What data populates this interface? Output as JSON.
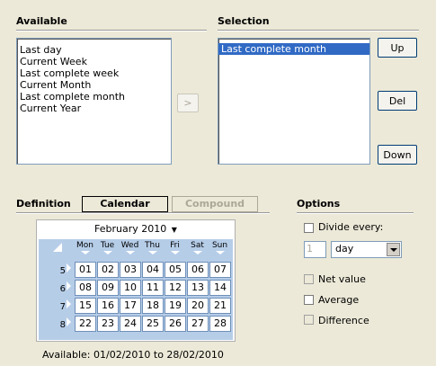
{
  "available": {
    "title": "Available",
    "items": [
      "Last day",
      "Current Week",
      "Last complete week",
      "Current Month",
      "Last complete month",
      "Current Year"
    ]
  },
  "move_button": {
    "label": ">"
  },
  "selection": {
    "title": "Selection",
    "items": [
      "Last complete month"
    ],
    "selected_index": 0
  },
  "side_buttons": {
    "up": "Up",
    "del": "Del",
    "down": "Down"
  },
  "definition": {
    "title": "Definition",
    "tabs": [
      {
        "label": "Calendar",
        "active": true
      },
      {
        "label": "Compound",
        "active": false
      }
    ]
  },
  "calendar": {
    "month_label": "February 2010",
    "dropdown_glyph": "▼",
    "weekdays": [
      "Mon",
      "Tue",
      "Wed",
      "Thu",
      "Fri",
      "Sat",
      "Sun"
    ],
    "weeks": [
      {
        "week": "5",
        "days": [
          "01",
          "02",
          "03",
          "04",
          "05",
          "06",
          "07"
        ]
      },
      {
        "week": "6",
        "days": [
          "08",
          "09",
          "10",
          "11",
          "12",
          "13",
          "14"
        ]
      },
      {
        "week": "7",
        "days": [
          "15",
          "16",
          "17",
          "18",
          "19",
          "20",
          "21"
        ]
      },
      {
        "week": "8",
        "days": [
          "22",
          "23",
          "24",
          "25",
          "26",
          "27",
          "28"
        ]
      }
    ],
    "available_text": "Available: 01/02/2010 to 28/02/2010"
  },
  "options": {
    "title": "Options",
    "divide_every": {
      "label": "Divide every:",
      "checked": false,
      "count": "1",
      "unit": "day"
    },
    "net_value": {
      "label": "Net value",
      "checked": false
    },
    "average": {
      "label": "Average",
      "checked": false
    },
    "difference": {
      "label": "Difference",
      "checked": false
    }
  }
}
